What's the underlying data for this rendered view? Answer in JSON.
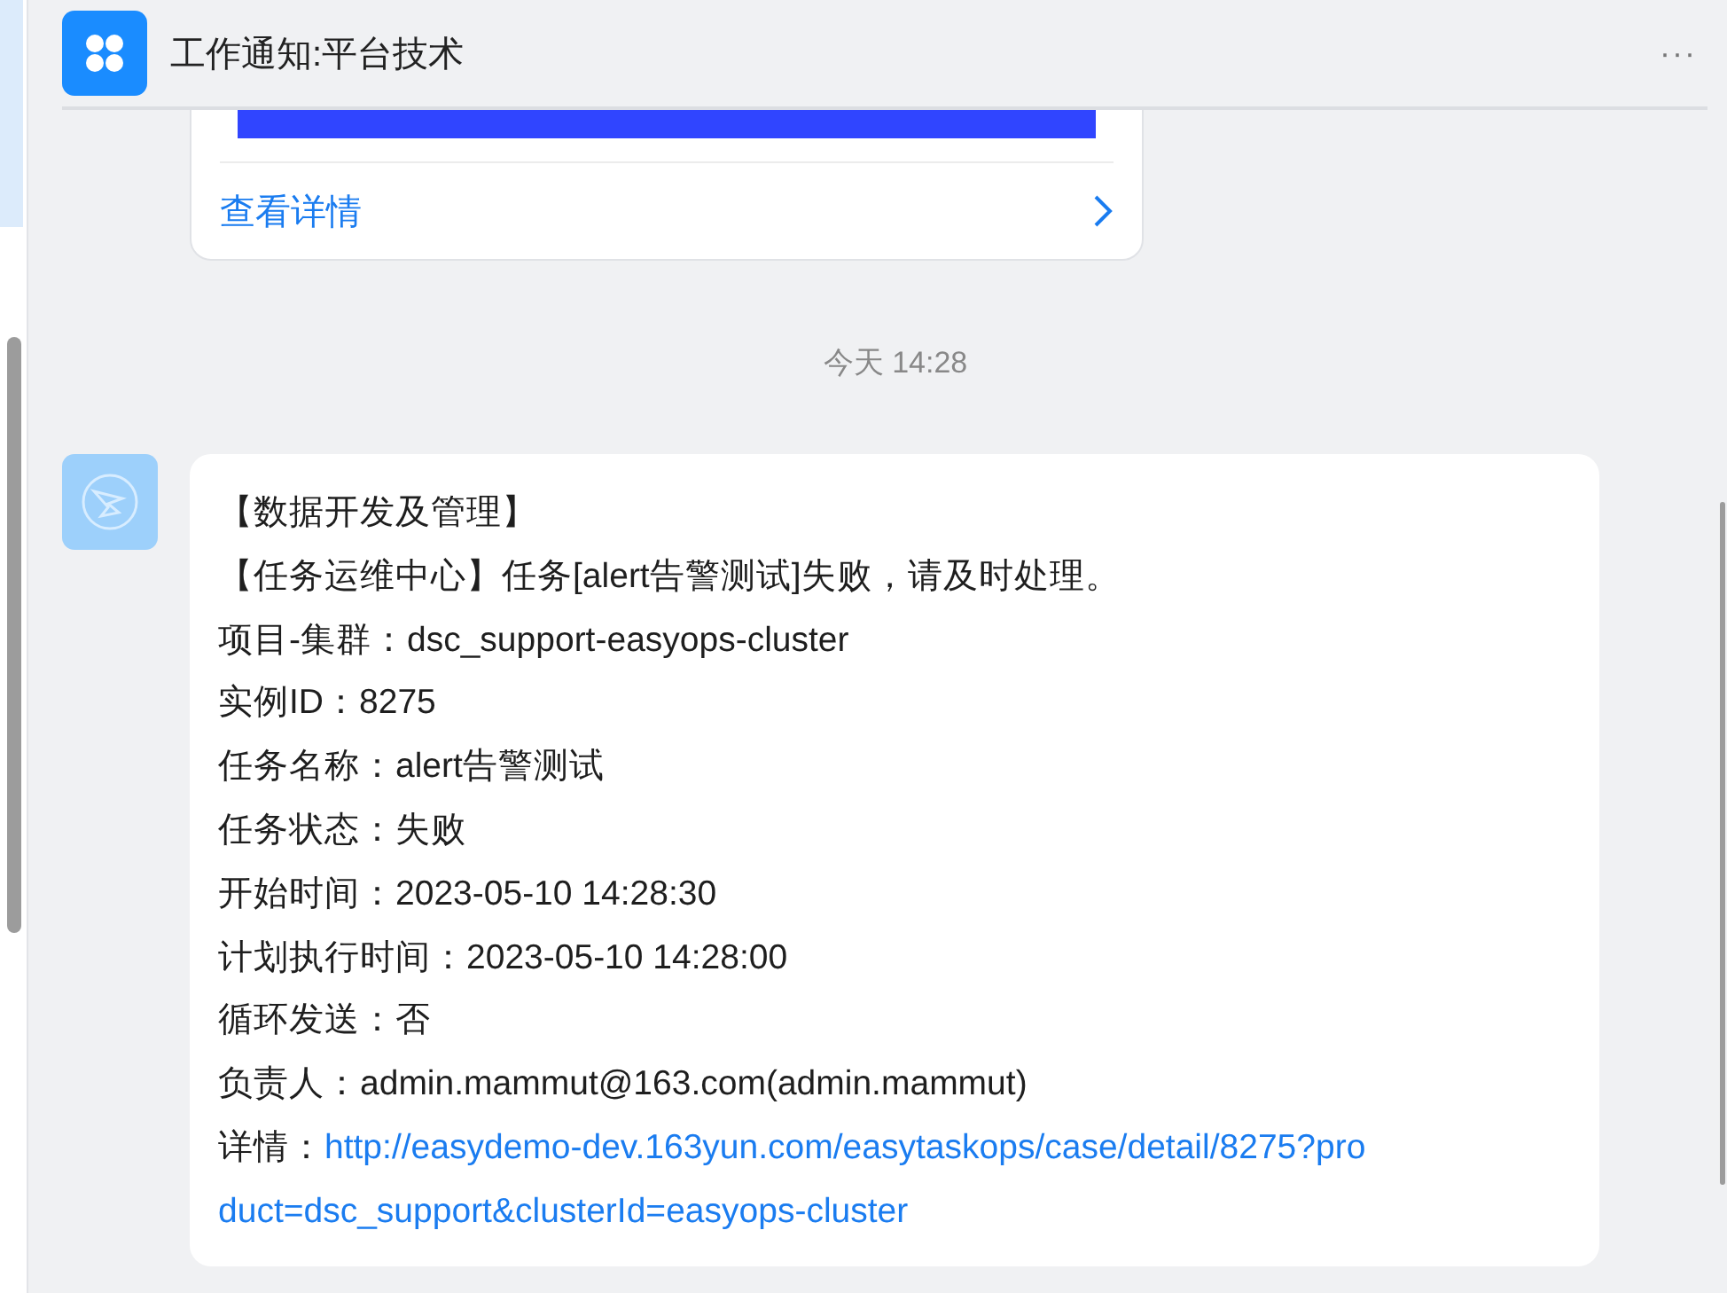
{
  "header": {
    "title": "工作通知:平台技术",
    "more": "···"
  },
  "prev_card": {
    "link": "查看详情"
  },
  "timestamp": "今天 14:28",
  "message": {
    "lines": [
      "【数据开发及管理】",
      "【任务运维中心】任务[alert告警测试]失败，请及时处理。",
      "项目-集群：dsc_support-easyops-cluster",
      "实例ID：8275",
      "任务名称：alert告警测试",
      "任务状态：失败",
      "开始时间：2023-05-10 14:28:30",
      "计划执行时间：2023-05-10 14:28:00",
      "循环发送：否",
      "负责人：admin.mammut@163.com(admin.mammut)"
    ],
    "detail": {
      "label": "详情：",
      "url_lines": [
        "http://easydemo-dev.163yun.com/easytaskops/case/detail/8275?pro",
        "duct=dsc_support&clusterId=easyops-cluster"
      ]
    }
  }
}
